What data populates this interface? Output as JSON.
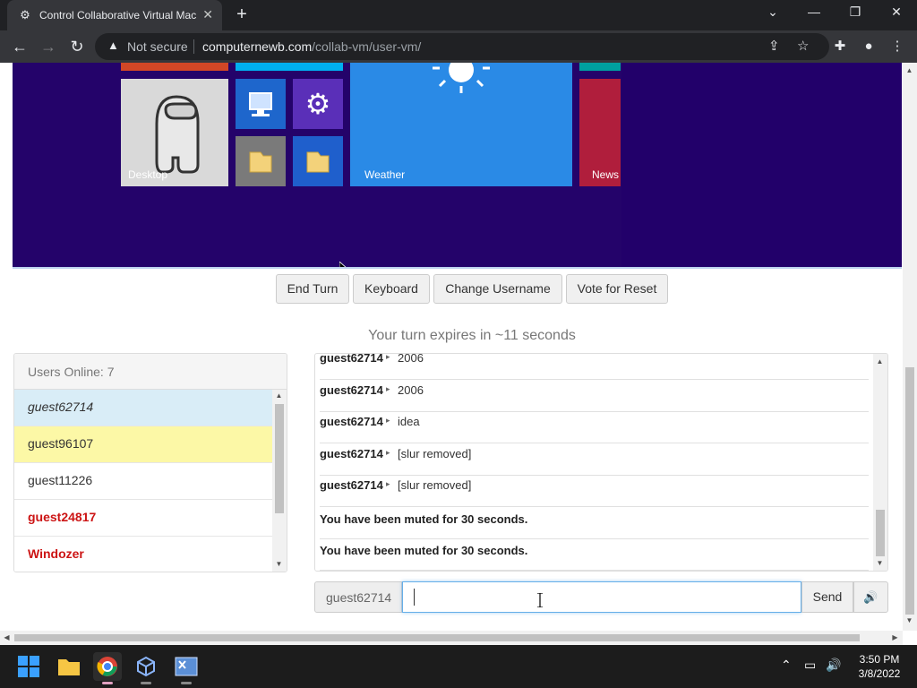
{
  "browser": {
    "tab_title": "Control Collaborative Virtual Mac",
    "tab_close": "✕",
    "new_tab": "+",
    "security": "Not secure",
    "url_host": "computernewb.com",
    "url_path": "/collab-vm/user-vm/",
    "window_controls": {
      "minimize": "—",
      "restore": "❐",
      "close": "✕"
    }
  },
  "vm_screen": {
    "tiles": {
      "desktop": "Desktop",
      "weather": "Weather",
      "news": "News"
    }
  },
  "controls": {
    "end_turn": "End Turn",
    "keyboard": "Keyboard",
    "change_username": "Change Username",
    "vote_reset": "Vote for Reset"
  },
  "turn_status": "Your turn expires in ~11 seconds",
  "users_panel": {
    "header": "Users Online: 7",
    "users": [
      {
        "name": "guest62714",
        "bg": "#d9edf7",
        "color": "#333333",
        "style": "italic",
        "weight": "normal"
      },
      {
        "name": "guest96107",
        "bg": "#fcf8a6",
        "color": "#333333",
        "style": "normal",
        "weight": "normal"
      },
      {
        "name": "guest11226",
        "bg": "#ffffff",
        "color": "#333333",
        "style": "normal",
        "weight": "normal"
      },
      {
        "name": "guest24817",
        "bg": "#ffffff",
        "color": "#cc1414",
        "style": "normal",
        "weight": "bold"
      },
      {
        "name": "Windozer",
        "bg": "#ffffff",
        "color": "#cc1414",
        "style": "normal",
        "weight": "bold"
      }
    ]
  },
  "chat": {
    "messages": [
      {
        "user": "guest62714",
        "text": "2006"
      },
      {
        "user": "guest62714",
        "text": "2006"
      },
      {
        "user": "guest62714",
        "text": "idea"
      },
      {
        "user": "guest62714",
        "text": "[slur removed]"
      },
      {
        "user": "guest62714",
        "text": "[slur removed]"
      }
    ],
    "system_messages": [
      "You have been muted for 30 seconds.",
      "You have been muted for 30 seconds."
    ],
    "username": "guest62714",
    "input_value": "",
    "send_label": "Send",
    "volume_icon": "🔊"
  },
  "taskbar": {
    "time": "3:50 PM",
    "date": "3/8/2022"
  }
}
